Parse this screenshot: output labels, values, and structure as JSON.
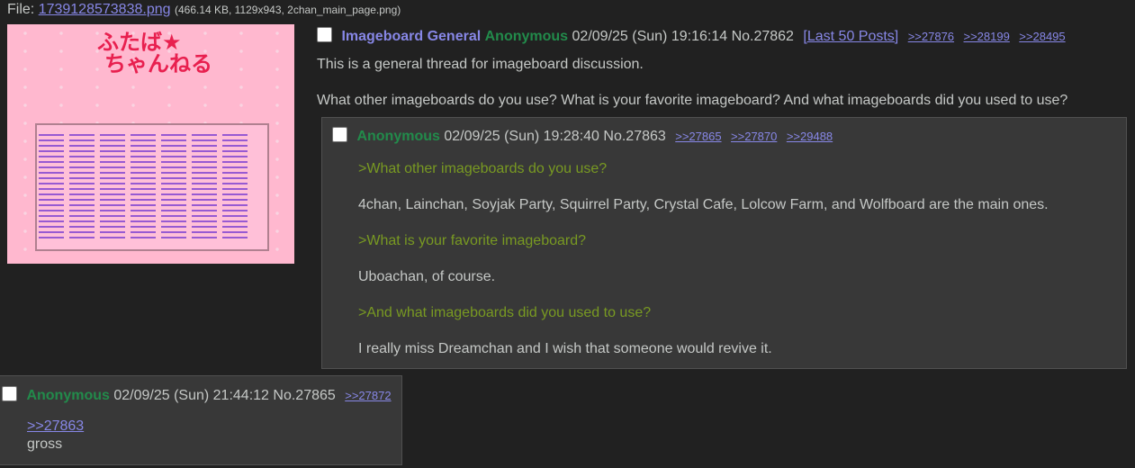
{
  "file": {
    "label": "File:",
    "filename": "1739128573838.png",
    "meta": "(466.14 KB, 1129x943, 2chan_main_page.png)"
  },
  "thumbnail": {
    "logo_line1": "ふたば★",
    "logo_line2": "ちゃんねる"
  },
  "op": {
    "subject": "Imageboard General",
    "name": "Anonymous",
    "datetime": "02/09/25 (Sun) 19:16:14",
    "post_no": "No.27862",
    "last50": "[Last 50 Posts]",
    "backlinks": [
      ">>27876",
      ">>28199",
      ">>28495"
    ],
    "paragraphs": [
      "This is a general thread for imageboard discussion.",
      "What other imageboards do you use?  What is your favorite imageboard?  And what imageboards did you used to use?"
    ]
  },
  "replies": [
    {
      "name": "Anonymous",
      "datetime": "02/09/25 (Sun) 19:28:40",
      "post_no": "No.27863",
      "backlinks": [
        ">>27865",
        ">>27870",
        ">>29488"
      ],
      "lines": [
        ">What other imageboards do you use?",
        "4chan, Lainchan, Soyjak Party, Squirrel Party, Crystal Cafe, Lolcow Farm, and Wolfboard are the main ones.",
        ">What is your favorite imageboard?",
        "Uboachan, of course.",
        ">And what imageboards did you used to use?",
        "I really miss Dreamchan and I wish that someone would revive it."
      ]
    },
    {
      "name": "Anonymous",
      "datetime": "02/09/25 (Sun) 21:44:12",
      "post_no": "No.27865",
      "backlinks": [
        ">>27872"
      ],
      "quote": ">>27863",
      "text": "gross"
    }
  ],
  "colors": {
    "background": "#212121",
    "text": "#c5c8c6",
    "subject": "#8787e6",
    "name": "#228b4b",
    "greentext": "#789922",
    "reply_bg": "#383838"
  }
}
